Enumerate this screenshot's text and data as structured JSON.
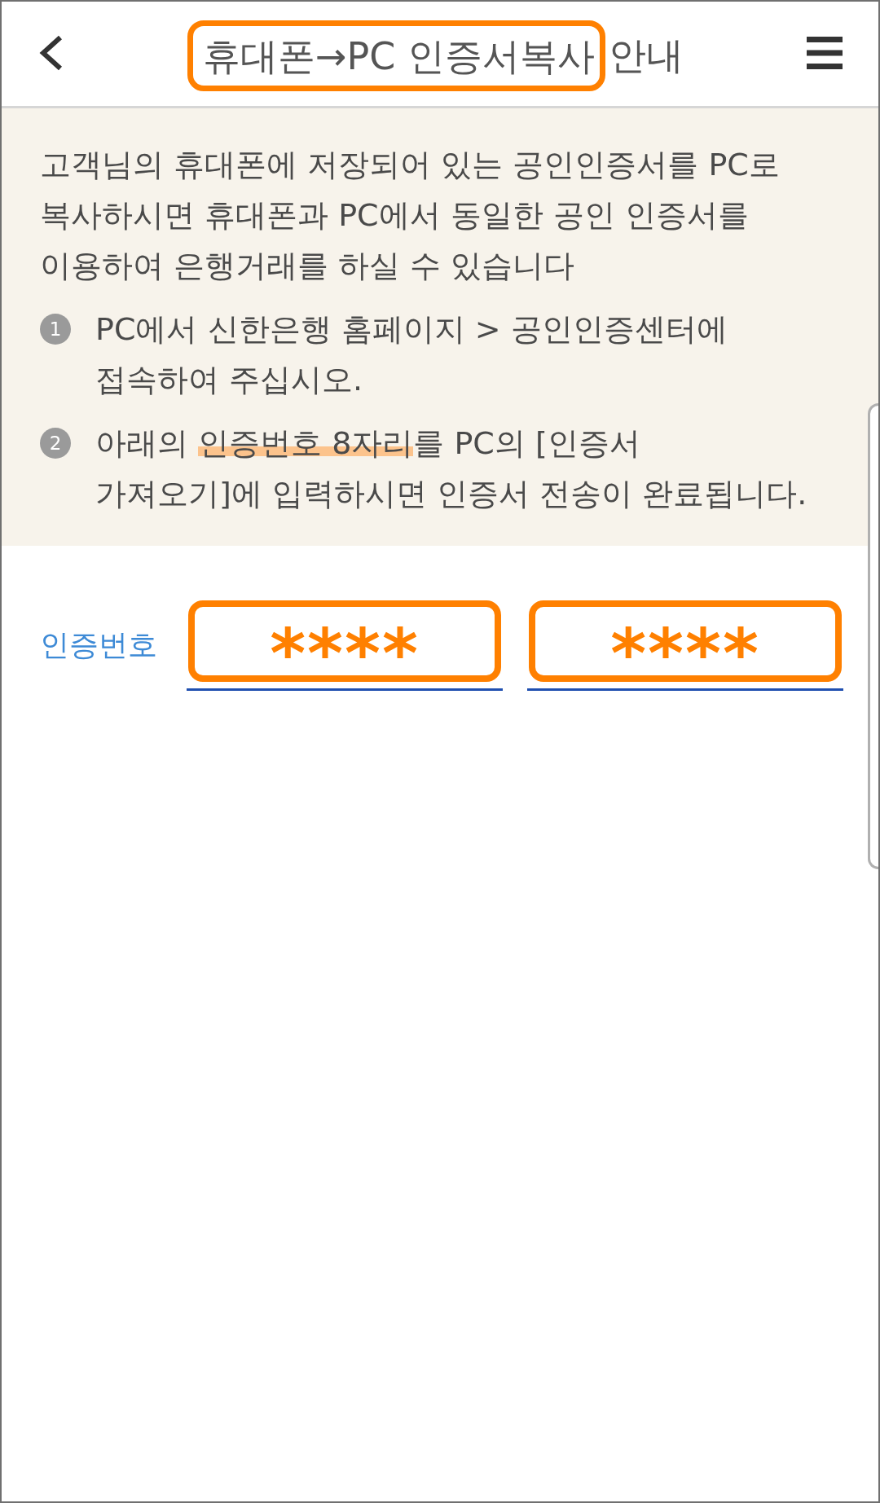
{
  "header": {
    "title_parts": [
      {
        "text": "휴대폰→PC 인증서복사",
        "highlighted": true
      },
      {
        "text": "안내",
        "highlighted": false
      }
    ]
  },
  "info_panel": {
    "intro_lines": [
      "고객님의 휴대폰에 저장되어 있는 공인인증서를 PC로",
      "복사하시면 휴대폰과 PC에서 동일한 공인 인증서를",
      "이용하여 은행거래를 하실 수 있습니다"
    ],
    "steps": [
      {
        "number": "1",
        "lines": [
          [
            {
              "text": "PC에서 신한은행 홈페이지 > 공인인증센터에",
              "highlighted": false
            }
          ],
          [
            {
              "text": "접속하여 주십시오.",
              "highlighted": false
            }
          ]
        ]
      },
      {
        "number": "2",
        "lines": [
          [
            {
              "text": "아래의 ",
              "highlighted": false
            },
            {
              "text": "인증번호 8자리",
              "highlighted": true
            },
            {
              "text": "를 PC의 [인증서",
              "highlighted": false
            }
          ],
          [
            {
              "text": "가져오기]에 입력하시면 인증서 전송이 완료됩니다.",
              "highlighted": false
            }
          ]
        ]
      }
    ]
  },
  "verification": {
    "label": "인증번호",
    "fields": [
      {
        "value": "****",
        "highlighted": true
      },
      {
        "value": "****",
        "highlighted": true
      }
    ]
  }
}
